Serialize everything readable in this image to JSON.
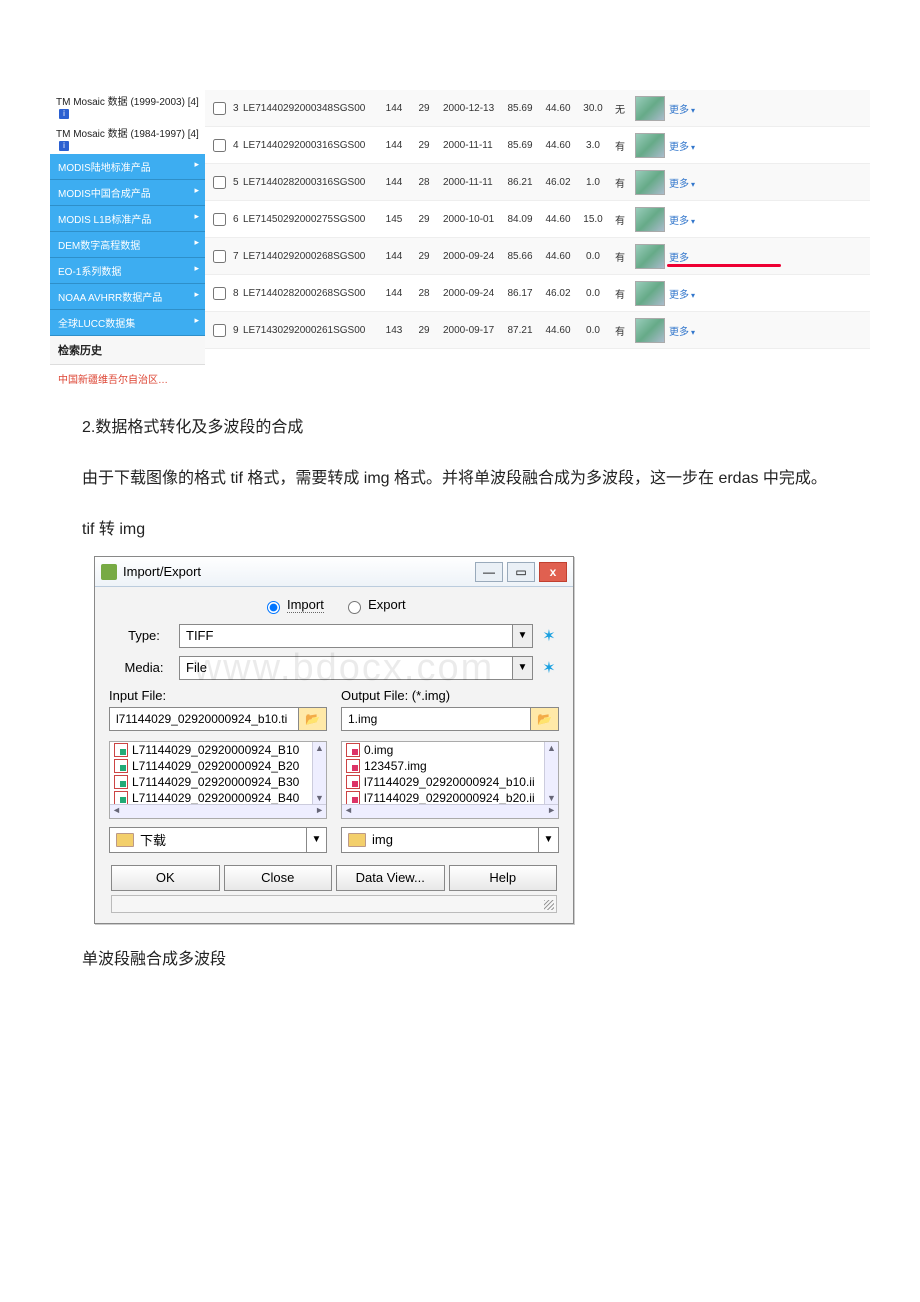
{
  "sidebar": {
    "plain": [
      "TM Mosaic 数据 (1999-2003) [4]",
      "TM Mosaic 数据 (1984-1997) [4]"
    ],
    "active": [
      "MODIS陆地标准产品",
      "MODIS中国合成产品",
      "MODIS L1B标准产品",
      "DEM数字高程数据",
      "EO-1系列数据",
      "NOAA AVHRR数据产品",
      "全球LUCC数据集"
    ],
    "history_header": "检索历史",
    "history_item": "中国新疆维吾尔自治区…"
  },
  "rows": [
    {
      "idx": "3",
      "id": "LE71440292000348SGS00",
      "p": "144",
      "r": "29",
      "date": "2000-12-13",
      "a": "85.69",
      "b": "44.60",
      "c": "30.0",
      "have": "无",
      "more": "更多"
    },
    {
      "idx": "4",
      "id": "LE71440292000316SGS00",
      "p": "144",
      "r": "29",
      "date": "2000-11-11",
      "a": "85.69",
      "b": "44.60",
      "c": "3.0",
      "have": "有",
      "more": "更多"
    },
    {
      "idx": "5",
      "id": "LE71440282000316SGS00",
      "p": "144",
      "r": "28",
      "date": "2000-11-11",
      "a": "86.21",
      "b": "46.02",
      "c": "1.0",
      "have": "有",
      "more": "更多"
    },
    {
      "idx": "6",
      "id": "LE71450292000275SGS00",
      "p": "145",
      "r": "29",
      "date": "2000-10-01",
      "a": "84.09",
      "b": "44.60",
      "c": "15.0",
      "have": "有",
      "more": "更多"
    },
    {
      "idx": "7",
      "id": "LE71440292000268SGS00",
      "p": "144",
      "r": "29",
      "date": "2000-09-24",
      "a": "85.66",
      "b": "44.60",
      "c": "0.0",
      "have": "有",
      "more": "更多",
      "hl": true
    },
    {
      "idx": "8",
      "id": "LE71440282000268SGS00",
      "p": "144",
      "r": "28",
      "date": "2000-09-24",
      "a": "86.17",
      "b": "46.02",
      "c": "0.0",
      "have": "有",
      "more": "更多"
    },
    {
      "idx": "9",
      "id": "LE71430292000261SGS00",
      "p": "143",
      "r": "29",
      "date": "2000-09-17",
      "a": "87.21",
      "b": "44.60",
      "c": "0.0",
      "have": "有",
      "more": "更多"
    }
  ],
  "text": {
    "h2": "2.数据格式转化及多波段的合成",
    "p1": "由于下载图像的格式 tif 格式，需要转成 img 格式。并将单波段融合成为多波段，这一步在 erdas 中完成。",
    "p2": "tif 转 img",
    "p3": "单波段融合成多波段"
  },
  "dialog": {
    "title": "Import/Export",
    "radio_import": "Import",
    "radio_export": "Export",
    "type_label": "Type:",
    "type_value": "TIFF",
    "media_label": "Media:",
    "media_value": "File",
    "watermark": "www.bdocx.com",
    "input_label": "Input File:",
    "output_label": "Output File: (*.img)",
    "input_value": "l71144029_02920000924_b10.ti",
    "output_value": "1.img",
    "left_files": [
      "L71144029_02920000924_B10",
      "L71144029_02920000924_B20",
      "L71144029_02920000924_B30",
      "L71144029_02920000924_B40"
    ],
    "right_files": [
      "0.img",
      "123457.img",
      "l71144029_02920000924_b10.ii",
      "l71144029_02920000924_b20.ii"
    ],
    "dir_left": "下载",
    "dir_right": "img",
    "btn_ok": "OK",
    "btn_close": "Close",
    "btn_dataview": "Data View...",
    "btn_help": "Help"
  }
}
